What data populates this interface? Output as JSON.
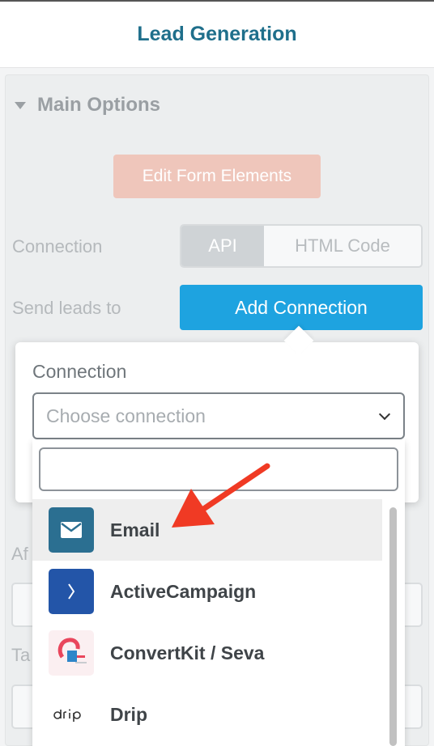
{
  "header": {
    "title": "Lead Generation"
  },
  "main_options": {
    "title": "Main Options",
    "edit_button": "Edit Form Elements",
    "connection_label": "Connection",
    "segments": [
      "API",
      "HTML Code"
    ],
    "send_leads_label": "Send leads to",
    "add_connection_button": "Add Connection"
  },
  "background_fragments": {
    "after_label_fragment": "Af",
    "tag_label_fragment": "Ta"
  },
  "popover": {
    "connection_label": "Connection",
    "select_placeholder": "Choose connection",
    "search_value": "",
    "options": [
      {
        "label": "Email",
        "icon": "envelope-icon",
        "color": "#2b6f91"
      },
      {
        "label": "ActiveCampaign",
        "icon": "activecampaign-icon",
        "color": "#2355a8"
      },
      {
        "label": "ConvertKit / Seva",
        "icon": "convertkit-icon",
        "color": "#e9465c"
      },
      {
        "label": "Drip",
        "icon": "drip-logo",
        "color": "#333333"
      }
    ]
  },
  "colors": {
    "accent_blue": "#1ea3e0",
    "title_teal": "#1f6f8b",
    "annotation_red": "#f03a24"
  }
}
